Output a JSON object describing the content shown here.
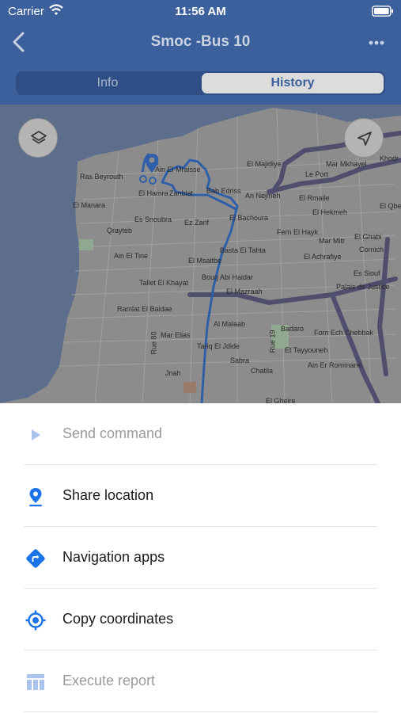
{
  "status": {
    "carrier": "Carrier",
    "time": "11:56 AM"
  },
  "navbar": {
    "title": "Smoc -Bus 10",
    "back_icon": "chevron-left-icon",
    "more_icon": "more-dots-icon"
  },
  "tabs": [
    {
      "label": "Info",
      "selected": false
    },
    {
      "label": "History",
      "selected": true
    }
  ],
  "map": {
    "places": [
      "Ras Beyrouth",
      "Ain El Mraisse",
      "El Hamra",
      "Zanblat",
      "Bab Edriss",
      "El Majidiye",
      "Mar Mkhayel",
      "Le Port",
      "Khodr",
      "El Manara",
      "Es Snoubra",
      "Ez Zarif",
      "An Nejmeh",
      "El Rmaile",
      "El Qbe",
      "El Hekmeh",
      "Qrayteb",
      "El Bachoura",
      "Fern El Hayk",
      "Mar Mitr",
      "El Ghabi",
      "Cornich",
      "Ain El Tine",
      "El Msaitbe",
      "Basta El Tahta",
      "El Achrafiye",
      "Es Siouf",
      "Tallet El Khayat",
      "Bourj Abi Haidar",
      "Palais de Justice",
      "El Mazraah",
      "Ramlat El Baidae",
      "Al Malaab",
      "Badaro",
      "Forn Ech Chebbak",
      "Mar Elias",
      "Tariq El Jdide",
      "Et Tayyouneh",
      "Sabra",
      "Ain Er Rommane",
      "Chatila",
      "Jnah",
      "El Gheire"
    ],
    "road_labels": [
      "Rue 80",
      "Rue 19"
    ],
    "route_color": "#2f5fa8",
    "layers_icon": "layers-icon",
    "locate_icon": "navigation-arrow-icon",
    "pin_icon": "map-pin-icon"
  },
  "actions": [
    {
      "label": "Send command",
      "icon": "play-triangle-icon",
      "enabled": false
    },
    {
      "label": "Share location",
      "icon": "location-pin-icon",
      "enabled": true
    },
    {
      "label": "Navigation apps",
      "icon": "directions-icon",
      "enabled": true
    },
    {
      "label": "Copy coordinates",
      "icon": "crosshair-target-icon",
      "enabled": true
    },
    {
      "label": "Execute report",
      "icon": "report-table-icon",
      "enabled": false
    }
  ],
  "colors": {
    "header": "#3c609b",
    "accent": "#1a73e8",
    "disabled_icon": "#a9c3ee"
  }
}
